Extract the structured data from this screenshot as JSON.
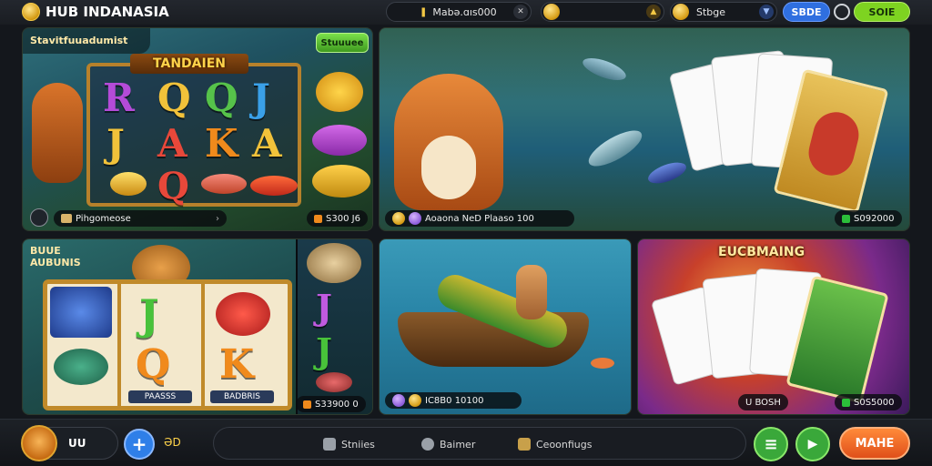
{
  "header": {
    "app_title": "HUB INDANASIA",
    "pill_1": "Mabə.ɑıs000",
    "pill_3": "Stbge",
    "btn_1": "SBDE",
    "btn_2": "SOIE"
  },
  "cards": {
    "slot_top": {
      "corner_label": "Stavitfuuadumist",
      "tab_label": "Stuuuee",
      "banner": "TANDAIEN",
      "reel_letters": [
        "R",
        "Q",
        "Q",
        "J",
        "J",
        "A",
        "K",
        "A",
        "Q"
      ],
      "footer_label": "Pihgomeose",
      "counter": "S300 J6"
    },
    "fishing_top": {
      "footer_label": "Aoaona NeD Plaaso 100",
      "counter": "S092000"
    },
    "slot_bottom": {
      "corner_label_1": "BUUE",
      "corner_label_2": "AUBUNIS",
      "reel_letters": [
        "J",
        "Q",
        "K"
      ],
      "side_letters": [
        "J",
        "J"
      ],
      "label_left": "PAASSS",
      "label_right": "BADBRIS",
      "counter": "S33900 0"
    },
    "fishing_bottom": {
      "footer_label": "IC8B0 10100"
    },
    "cards_bottom": {
      "banner": "EUCBMAING",
      "counter_1": "U BOSH",
      "counter_2": "S0S5000"
    }
  },
  "bottombar": {
    "avatar_label": "UU",
    "plus_label": "+",
    "count_label": "ƏD",
    "nav": [
      "Stniies",
      "Baimer",
      "Ceoonfiugs"
    ],
    "btn_menu": "≡",
    "btn_play": "▶",
    "primary_button": "MAHE"
  },
  "colors": {
    "accent_green": "#7ed321",
    "accent_blue": "#2f6fe0",
    "accent_orange": "#f0691c",
    "gold": "#f3c844"
  }
}
